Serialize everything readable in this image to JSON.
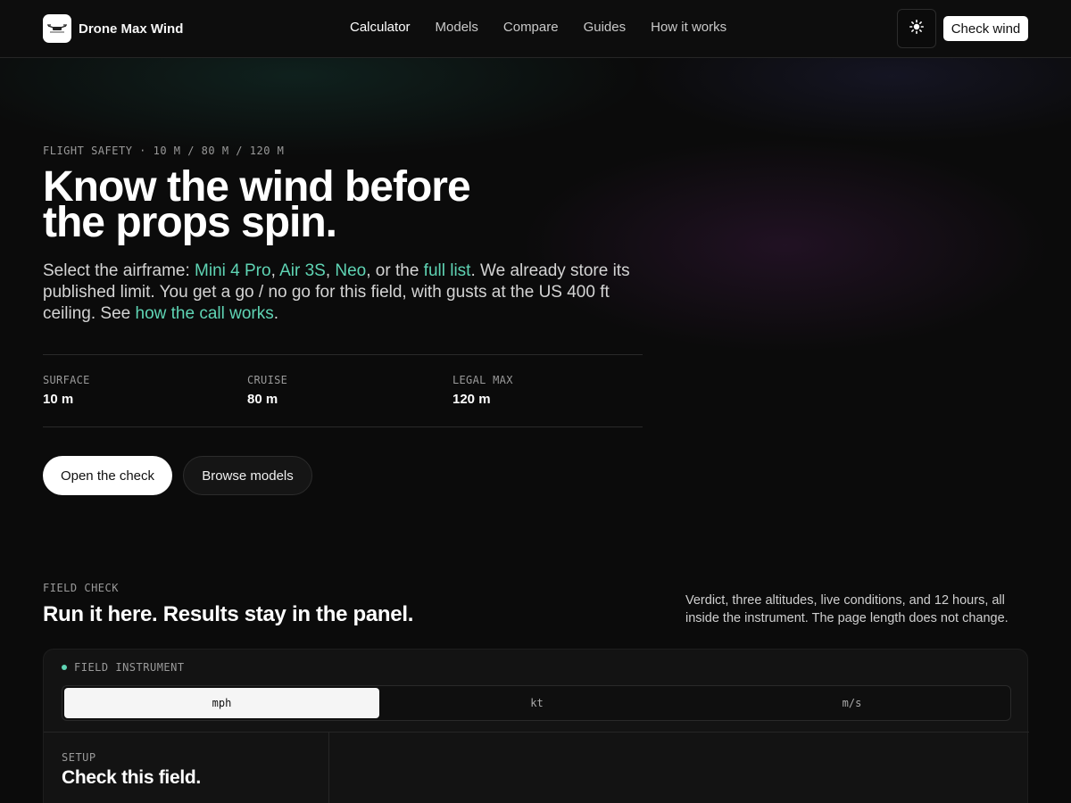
{
  "brand": {
    "name": "Drone Max Wind",
    "logo_icon": "drone-icon"
  },
  "nav": {
    "items": [
      {
        "label": "Calculator",
        "active": true
      },
      {
        "label": "Models",
        "active": false
      },
      {
        "label": "Compare",
        "active": false
      },
      {
        "label": "Guides",
        "active": false
      },
      {
        "label": "How it works",
        "active": false
      }
    ],
    "theme_icon": "sun-icon",
    "cta_label": "Check wind"
  },
  "hero": {
    "eyebrow": "FLIGHT SAFETY · 10 M / 80 M / 120 M",
    "title_line1": "Know the wind before",
    "title_line2": "the props spin.",
    "lede": {
      "t1": "Select the airframe: ",
      "link1": "Mini 4 Pro",
      "t2": ", ",
      "link2": "Air 3S",
      "t3": ", ",
      "link3": "Neo",
      "t4": ", or the ",
      "link4": "full list",
      "t5": ". We already store its published limit. You get a go / no go for this field, with gusts at the US 400 ft ceiling. See ",
      "link5": "how the call works",
      "t6": "."
    },
    "stats": [
      {
        "label": "SURFACE",
        "value": "10 m"
      },
      {
        "label": "CRUISE",
        "value": "80 m"
      },
      {
        "label": "LEGAL MAX",
        "value": "120 m"
      }
    ],
    "primary_button": "Open the check",
    "secondary_button": "Browse models"
  },
  "field_check": {
    "eyebrow": "FIELD CHECK",
    "title": "Run it here. Results stay in the panel.",
    "note": "Verdict, three altitudes, live conditions, and 12 hours, all inside the instrument. The page length does not change.",
    "panel": {
      "label": "FIELD INSTRUMENT",
      "units": [
        {
          "label": "mph",
          "selected": true
        },
        {
          "label": "kt",
          "selected": false
        },
        {
          "label": "m/s",
          "selected": false
        }
      ],
      "setup_label": "SETUP",
      "setup_title": "Check this field."
    }
  },
  "colors": {
    "accent": "#5fd4b4",
    "background": "#0b0b0b",
    "text": "#f2f2f2"
  }
}
